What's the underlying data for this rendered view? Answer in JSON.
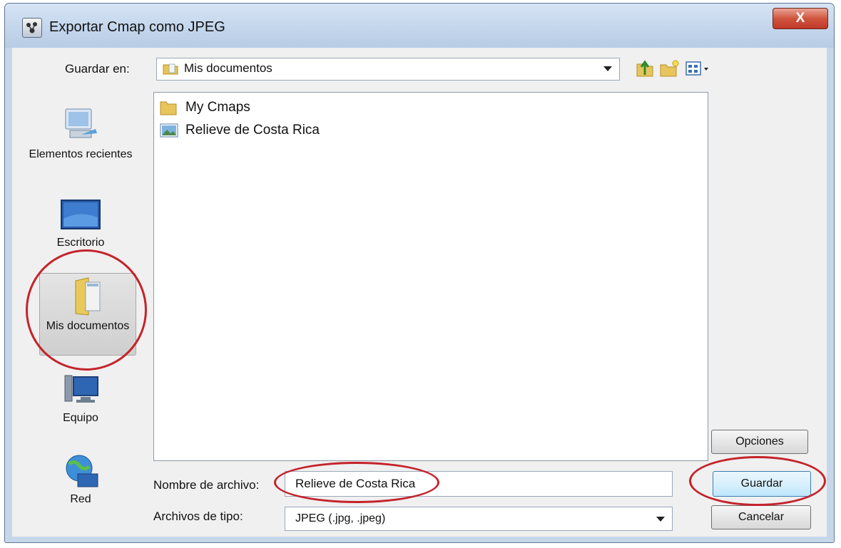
{
  "window": {
    "title": "Exportar Cmap como JPEG",
    "close_label": "X"
  },
  "toolbar": {
    "save_in_label": "Guardar en:",
    "save_in_value": "Mis documentos",
    "icons": [
      "up-folder-icon",
      "new-folder-icon",
      "view-menu-icon"
    ]
  },
  "places": [
    {
      "label": "Elementos recientes",
      "icon": "recent-items-icon"
    },
    {
      "label": "Escritorio",
      "icon": "desktop-icon"
    },
    {
      "label": "Mis documentos",
      "icon": "documents-folder-icon",
      "selected": true
    },
    {
      "label": "Equipo",
      "icon": "computer-icon"
    },
    {
      "label": "Red",
      "icon": "network-icon"
    }
  ],
  "files": [
    {
      "name": "My Cmaps",
      "icon": "folder-icon"
    },
    {
      "name": "Relieve de Costa Rica",
      "icon": "image-file-icon"
    }
  ],
  "form": {
    "filename_label": "Nombre de archivo:",
    "filename_value": "Relieve de Costa Rica",
    "filetype_label": "Archivos de tipo:",
    "filetype_value": "JPEG (.jpg, .jpeg)"
  },
  "buttons": {
    "options": "Opciones",
    "save": "Guardar",
    "cancel": "Cancelar"
  },
  "colors": {
    "highlight_ring": "#c4232b",
    "title_bar": "#c4d6ec",
    "close_button": "#c0382a"
  }
}
